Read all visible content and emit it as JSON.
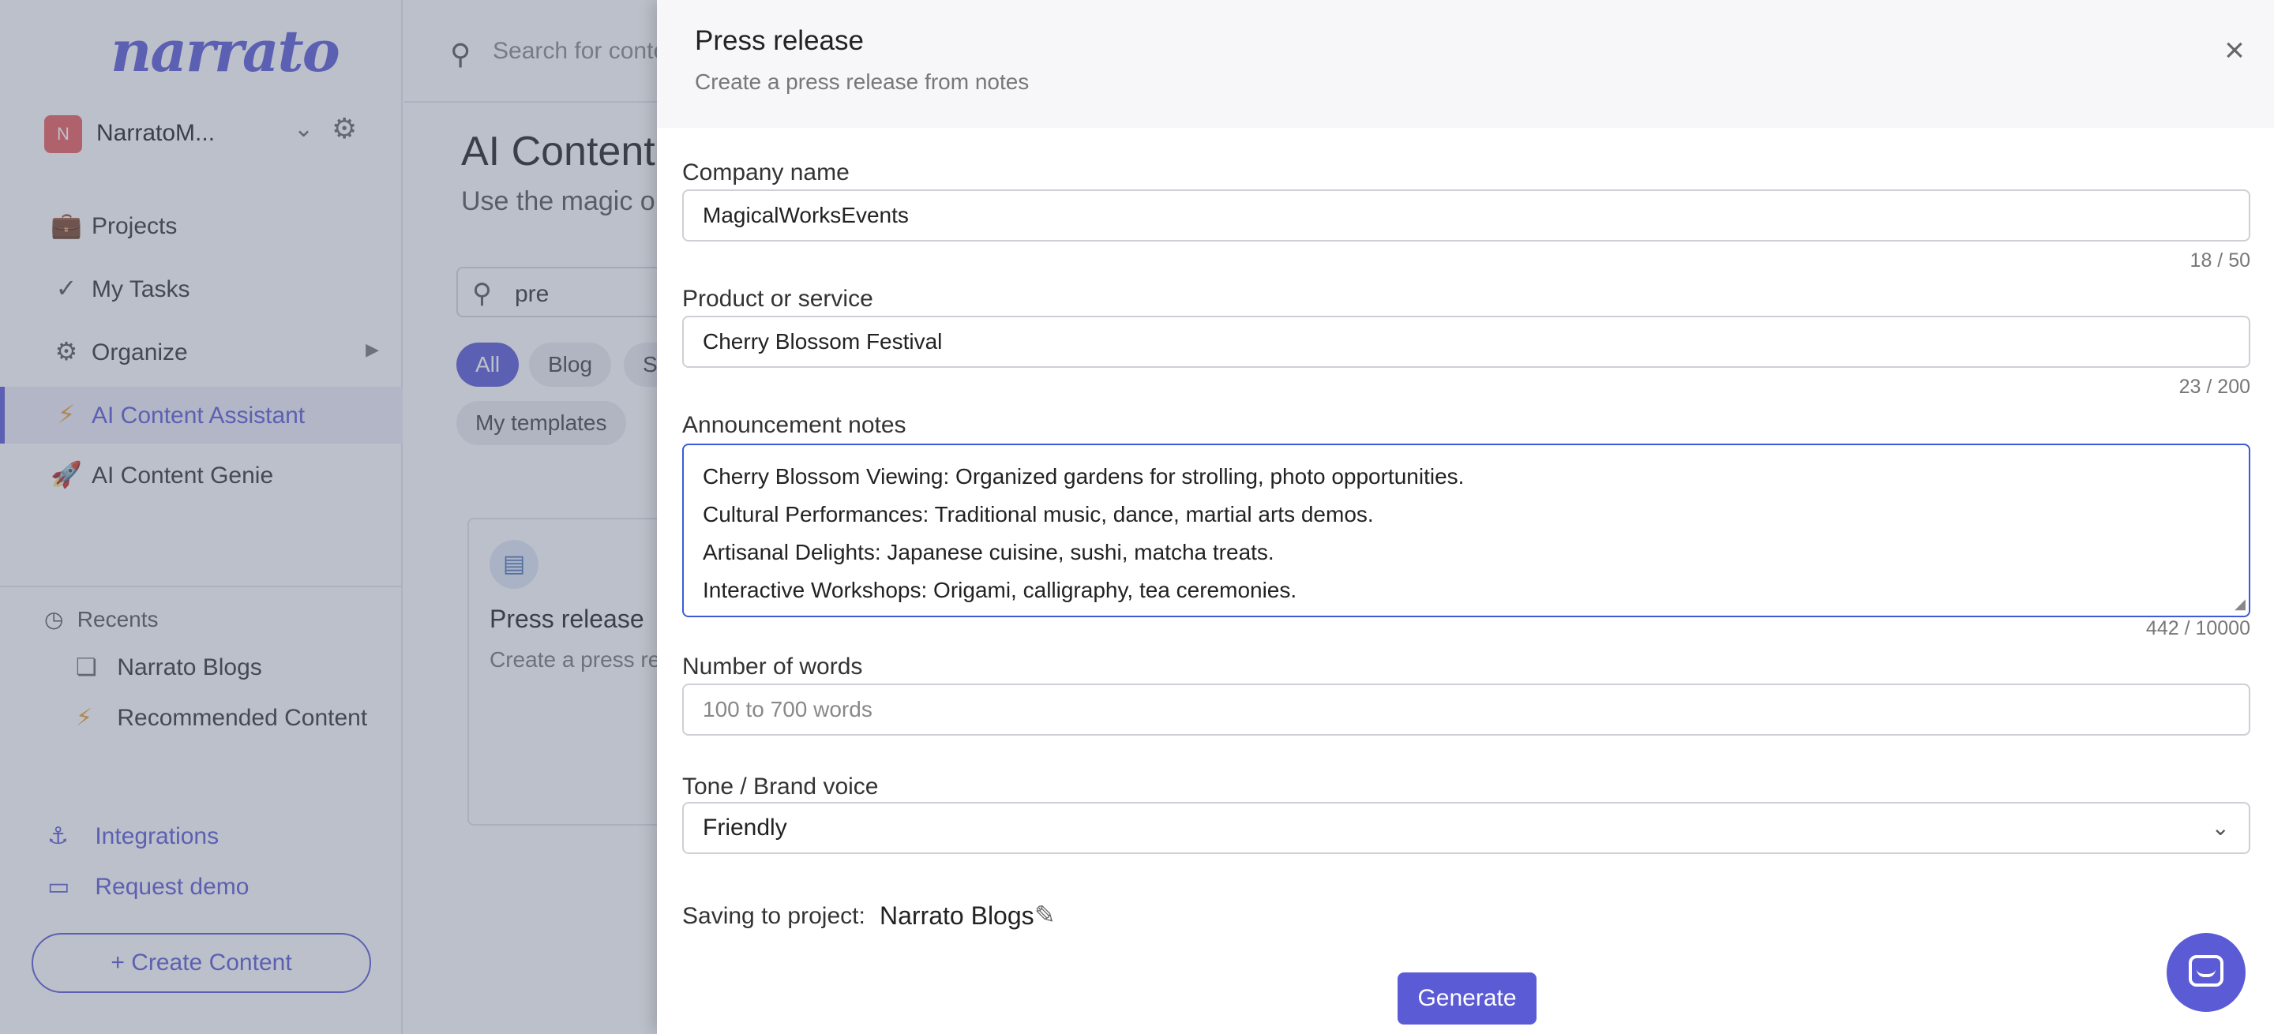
{
  "app": {
    "logo": "narrato",
    "workspace": {
      "avatar": "N",
      "name": "NarratoM..."
    },
    "top_search": {
      "placeholder": "Search for conte"
    },
    "nav": [
      {
        "icon": "briefcase-icon",
        "label": "Projects"
      },
      {
        "icon": "check-icon",
        "label": "My Tasks"
      },
      {
        "icon": "gears-icon",
        "label": "Organize"
      },
      {
        "icon": "lightning-icon",
        "label": "AI Content Assistant",
        "active": true
      },
      {
        "icon": "rocket-icon",
        "label": "AI Content Genie"
      }
    ],
    "recents": {
      "heading": "Recents",
      "items": [
        {
          "icon": "cube-icon",
          "label": "Narrato Blogs"
        },
        {
          "icon": "lightning-icon",
          "label": "Recommended Content"
        }
      ]
    },
    "links": [
      {
        "icon": "anchor-icon",
        "label": "Integrations"
      },
      {
        "icon": "monitor-icon",
        "label": "Request demo"
      }
    ],
    "create_button": "+ Create Content",
    "main": {
      "title": "AI Content",
      "subtitle": "Use the magic o",
      "template_search_value": "pre",
      "chips": [
        "All",
        "Blog",
        "S"
      ],
      "chip_my_templates": "My templates",
      "card": {
        "title": "Press release",
        "desc": "Create a press rel"
      }
    }
  },
  "panel": {
    "title": "Press release",
    "subtitle": "Create a press release from notes",
    "fields": {
      "company": {
        "label": "Company name",
        "value": "MagicalWorksEvents",
        "counter": "18 / 50"
      },
      "product": {
        "label": "Product or service",
        "value": "Cherry Blossom Festival",
        "counter": "23 / 200"
      },
      "notes": {
        "label": "Announcement notes",
        "lines": [
          "Cherry Blossom Viewing: Organized gardens for strolling, photo opportunities.",
          "Cultural Performances: Traditional music, dance, martial arts demos.",
          "Artisanal Delights: Japanese cuisine, sushi, matcha treats.",
          "Interactive Workshops: Origami, calligraphy, tea ceremonies."
        ],
        "counter": "442 / 10000"
      },
      "words": {
        "label": "Number of words",
        "placeholder": "100 to 700 words"
      },
      "tone": {
        "label": "Tone / Brand voice",
        "value": "Friendly"
      }
    },
    "saving": {
      "label": "Saving to project:",
      "project": "Narrato Blogs"
    },
    "generate_label": "Generate"
  },
  "colors": {
    "accent": "#5b5bd6",
    "focus_border": "#3b5bdb"
  }
}
